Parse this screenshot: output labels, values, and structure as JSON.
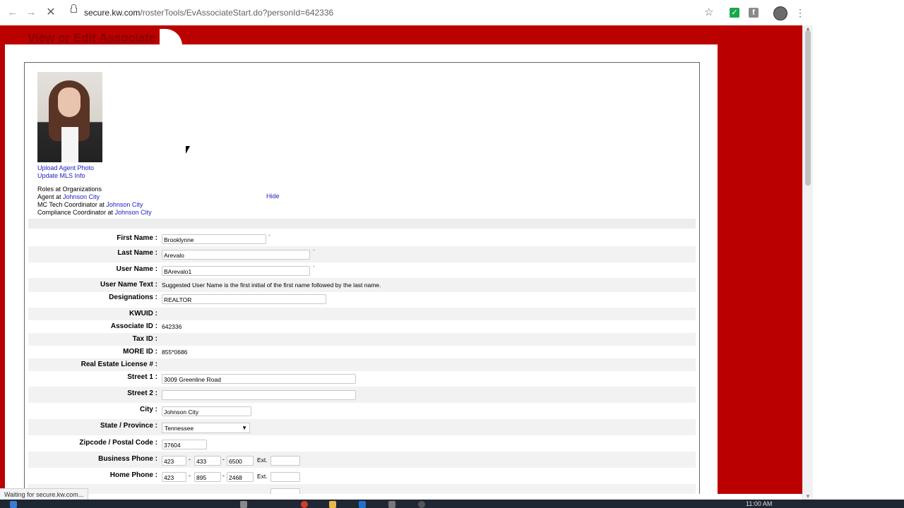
{
  "browser": {
    "url_host": "secure.kw.com",
    "url_path": "/rosterTools/EvAssociateStart.do?personId=642336",
    "status_text": "Waiting for secure.kw.com...",
    "clock": "11:00 AM"
  },
  "page": {
    "title": "View or Edit Associate",
    "upload_photo_link": "Upload Agent Photo",
    "update_mls_link": "Update MLS Info",
    "roles_heading": "Roles at Organizations",
    "roles": [
      {
        "role": "Agent at ",
        "org": "Johnson City"
      },
      {
        "role": "MC Tech Coordinator at ",
        "org": "Johnson City"
      },
      {
        "role": "Compliance Coordinator at ",
        "org": "Johnson City"
      }
    ],
    "hide_link": "Hide"
  },
  "form": {
    "first_name": {
      "label": "First Name :",
      "value": "Brooklynne",
      "required": "*"
    },
    "last_name": {
      "label": "Last Name :",
      "value": "Arevalo",
      "required": "*"
    },
    "user_name": {
      "label": "User Name :",
      "value": "BArevalo1",
      "required": "*"
    },
    "user_name_text": {
      "label": "User Name Text :",
      "value": "Suggested User Name is the first initial of the first name followed by the last name."
    },
    "designations": {
      "label": "Designations :",
      "value": "REALTOR"
    },
    "kwuid": {
      "label": "KWUID :",
      "value": ""
    },
    "associate_id": {
      "label": "Associate ID :",
      "value": "642336"
    },
    "tax_id": {
      "label": "Tax ID :",
      "value": ""
    },
    "more_id": {
      "label": "MORE ID :",
      "value": "855*0686"
    },
    "license": {
      "label": "Real Estate License # :",
      "value": ""
    },
    "street1": {
      "label": "Street 1 :",
      "value": "3009 Greenline Road"
    },
    "street2": {
      "label": "Street 2 :",
      "value": ""
    },
    "city": {
      "label": "City :",
      "value": "Johnson City"
    },
    "state": {
      "label": "State / Province :",
      "value": "Tennessee"
    },
    "zip": {
      "label": "Zipcode / Postal Code :",
      "value": "37604"
    },
    "business_phone": {
      "label": "Business Phone :",
      "area": "423",
      "prefix": "433",
      "line": "6500",
      "ext_label": "Ext.",
      "ext": ""
    },
    "home_phone": {
      "label": "Home Phone :",
      "area": "423",
      "prefix": "895",
      "line": "2468",
      "ext_label": "Ext.",
      "ext": ""
    },
    "dash": "-"
  }
}
